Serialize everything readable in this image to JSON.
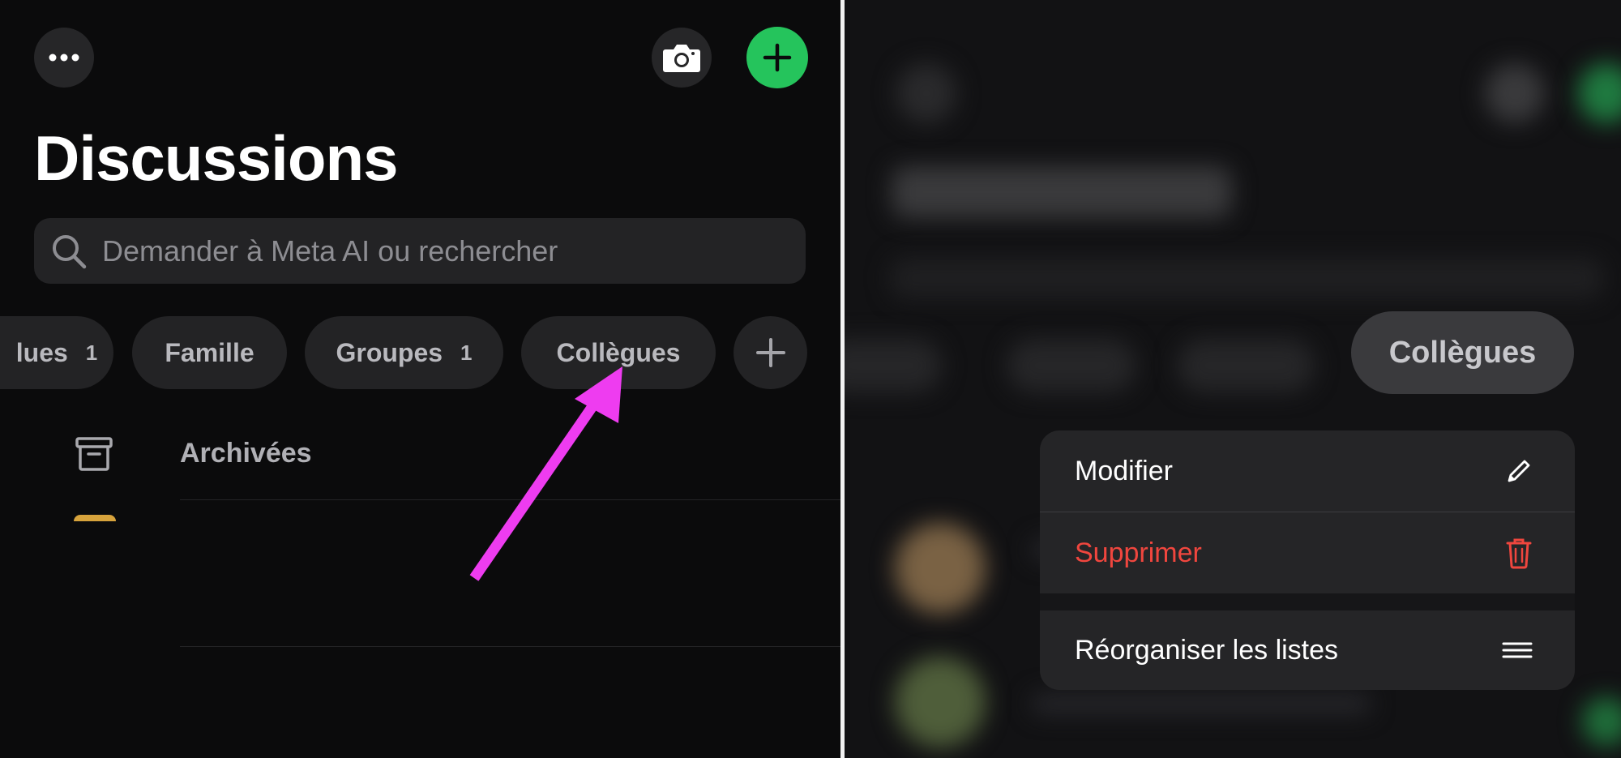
{
  "left": {
    "title": "Discussions",
    "search": {
      "placeholder": "Demander à Meta AI ou rechercher"
    },
    "filters": [
      {
        "label": "lues",
        "count": "1"
      },
      {
        "label": "Famille",
        "count": ""
      },
      {
        "label": "Groupes",
        "count": "1"
      },
      {
        "label": "Collègues",
        "count": ""
      }
    ],
    "archived_label": "Archivées",
    "icons": {
      "more": "more-horizontal-icon",
      "camera": "camera-icon",
      "new_chat": "plus-icon",
      "add_list": "plus-icon",
      "archive": "archive-box-icon",
      "annotation": "pink-arrow-icon"
    }
  },
  "right": {
    "selected_chip": "Collègues",
    "context_menu": [
      {
        "label": "Modifier",
        "icon": "pencil-icon"
      },
      {
        "label": "Supprimer",
        "icon": "trash-icon",
        "destructive": true
      },
      {
        "label": "Réorganiser les listes",
        "icon": "reorder-lines-icon"
      }
    ]
  },
  "colors": {
    "accent_green": "#25c45c",
    "destructive_red": "#f0463e",
    "annotation_pink": "#ee3cf0"
  }
}
